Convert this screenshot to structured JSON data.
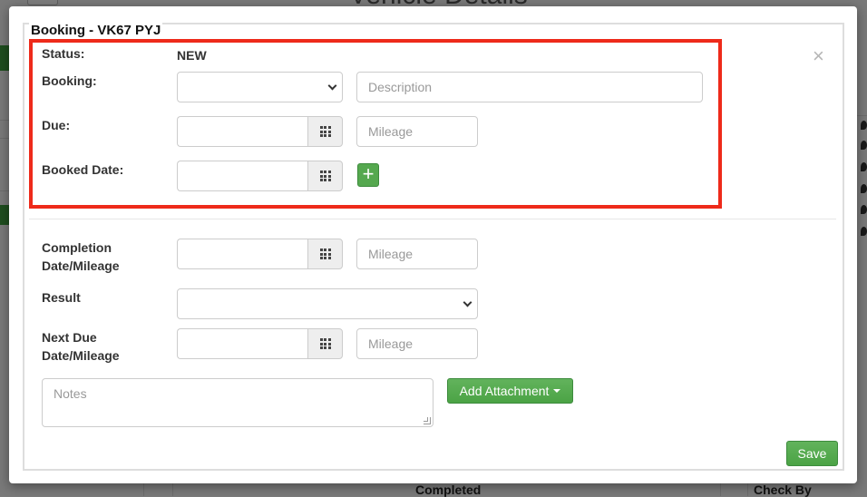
{
  "background": {
    "page_title": "Vehicle Details",
    "bottom_col_completed": "Completed",
    "bottom_col_check_by": "Check By"
  },
  "modal": {
    "title": "Booking - VK67 PYJ",
    "close_glyph": "×",
    "status_label": "Status:",
    "status_value": "NEW",
    "booking_label": "Booking:",
    "booking_select_value": "",
    "description_placeholder": "Description",
    "due_label": "Due:",
    "due_mileage_placeholder": "Mileage",
    "booked_date_label": "Booked Date:",
    "add_booking_glyph": "+",
    "completion_label_line1": "Completion",
    "completion_label_line2": "Date/Mileage",
    "completion_mileage_placeholder": "Mileage",
    "result_label": "Result",
    "result_select_value": "",
    "next_due_label_line1": "Next Due",
    "next_due_label_line2": "Date/Mileage",
    "next_due_mileage_placeholder": "Mileage",
    "notes_placeholder": "Notes",
    "add_attachment_label": "Add Attachment",
    "save_label": "Save"
  },
  "icons": {
    "calendar": "grid-icon",
    "dropdown": "chevron-down-icon",
    "close": "close-icon"
  },
  "colors": {
    "highlight_border": "#ee2a1a",
    "button_green": "#4ba345"
  }
}
